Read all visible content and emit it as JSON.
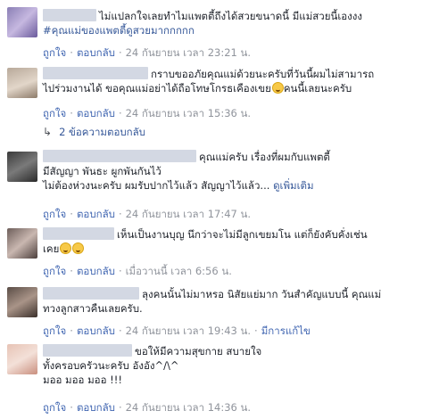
{
  "comments": [
    {
      "lines": [
        "ไม่แปลกใจเลยทำไมแพตตี้ถึงได้สวยขนาดนี้ มีแม่สวยนี้เองงง"
      ],
      "hashtag": "#คุณแม่ของแพตตี้ดูสวยมากกกกก",
      "like": "ถูกใจ",
      "reply": "ตอบกลับ",
      "time": "24 กันยายน เวลา 23:21 น."
    },
    {
      "lines": [
        "กราบขออภัยคุณแม่ด้วยนะครับที่วันนี้ผมไม่สามารถ",
        "ไปร่วมงานได้ ขอคุณแม่อย่าได้ถือโทษโกรธเคืองเขย",
        "คนนี้เลยนะครับ"
      ],
      "like": "ถูกใจ",
      "reply": "ตอบกลับ",
      "time": "24 กันยายน เวลา 15:36 น.",
      "replies_label": "2 ข้อความตอบกลับ"
    },
    {
      "lines": [
        "คุณแม่ครับ เรื่องที่ผมกับแพตตี้",
        "มีสัญญา พันธะ ผูกพันกันไว้",
        "ไม่ต้องห่วงนะครับ ผมรับปากไว้แล้ว สัญญาไว้แล้ว..."
      ],
      "see_more": "ดูเพิ่มเติม",
      "like": "ถูกใจ",
      "reply": "ตอบกลับ",
      "time": "24 กันยายน เวลา 17:47 น."
    },
    {
      "lines": [
        "เห็นเป็นงานบุญ นึกว่าจะไม่มีลูกเขยมโน แต่ก็ยังคับคั่งเช่น",
        "เคย"
      ],
      "like": "ถูกใจ",
      "reply": "ตอบกลับ",
      "time": "เมื่อวานนี้ เวลา 6:56 น."
    },
    {
      "lines": [
        "ลุงคนนั้นไม่มาหรอ นิสัยแย่มาก วันสำคัญแบบนี้ คุณแม่",
        "ทวงลูกสาวคืนเลยครับ."
      ],
      "like": "ถูกใจ",
      "reply": "ตอบกลับ",
      "time": "24 กันยายน เวลา 19:43 น.",
      "edited": "มีการแก้ไข"
    },
    {
      "lines": [
        "ขอให้มีความสุขกาย สบายใจ",
        "ทั้งครอบครัวนะครับ อังอัง^/\\^",
        "มออ มออ มออ !!!"
      ],
      "like": "ถูกใจ",
      "reply": "ตอบกลับ",
      "time": "24 กันยายน เวลา 14:36 น."
    }
  ],
  "colors": {
    "link": "#4267b2",
    "meta": "#90949c",
    "text": "#1d2129",
    "name_redacted": "#d3d8e3"
  },
  "icons": {
    "emoji": "grinning-sweat-emoji",
    "reply_arrow": "reply-arrow-icon"
  }
}
